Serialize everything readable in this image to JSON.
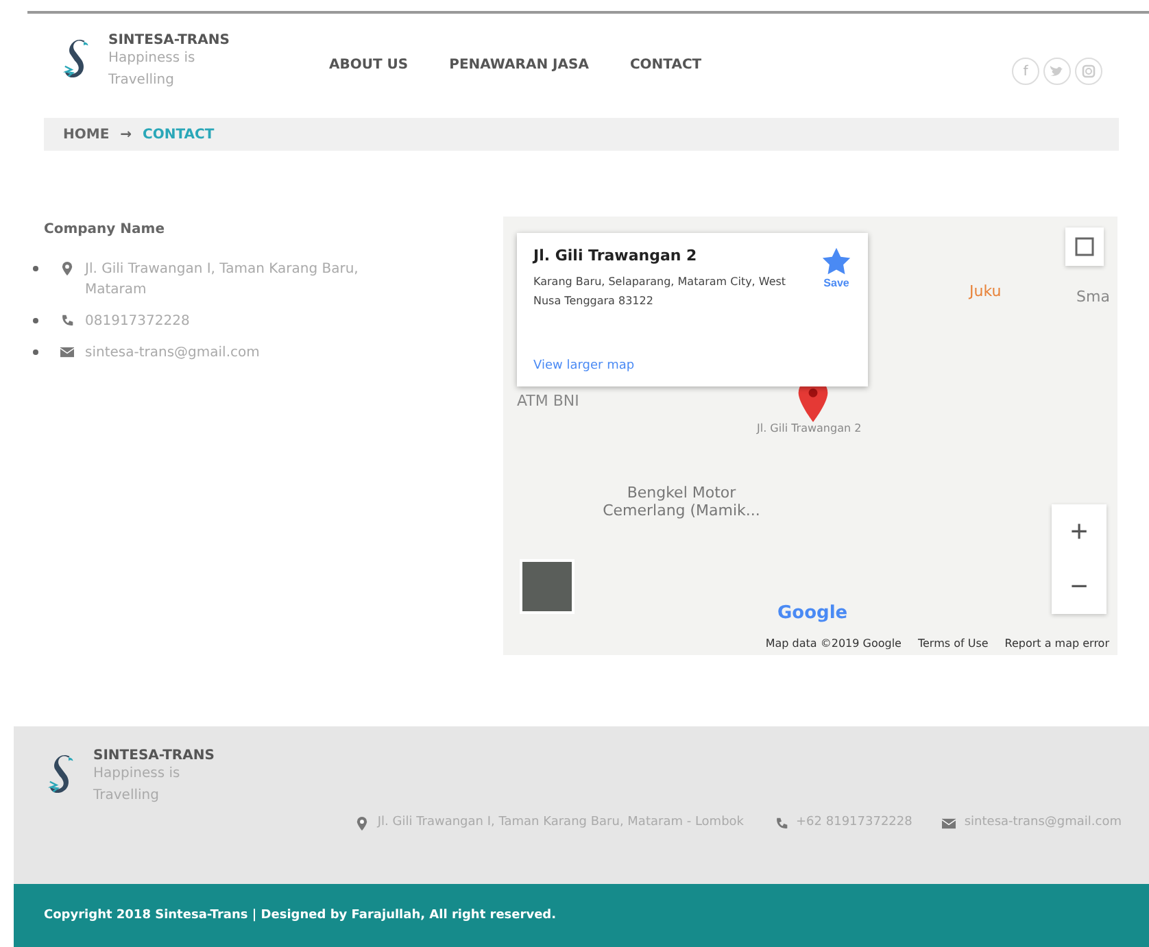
{
  "brand": {
    "name": "SINTESA-TRANS",
    "tagline": "Happiness is Travelling"
  },
  "nav": [
    {
      "label": "ABOUT US",
      "selected": false
    },
    {
      "label": "PENAWARAN JASA",
      "selected": false
    },
    {
      "label": "CONTACT",
      "selected": false
    }
  ],
  "social": [
    {
      "kind": "facebook",
      "label": "f"
    },
    {
      "kind": "twitter"
    },
    {
      "kind": "instagram"
    }
  ],
  "breadcrumb": [
    {
      "label": "HOME",
      "selected": false
    },
    {
      "label": "→",
      "selected": false
    },
    {
      "label": "CONTACT",
      "selected": true
    }
  ],
  "contact": {
    "title": "Company Name",
    "items": [
      {
        "kind": "address",
        "text": "Jl. Gili Trawangan I, Taman Karang Baru, Mataram"
      },
      {
        "kind": "phone",
        "text": "081917372228"
      },
      {
        "kind": "email",
        "text": "sintesa-trans@gmail.com"
      }
    ]
  },
  "map": {
    "card": {
      "title": "Jl. Gili Trawangan 2",
      "address": "Karang Baru, Selaparang, Mataram City, West Nusa Tenggara 83122",
      "save": "Save",
      "link": "View larger map"
    },
    "labels": [
      {
        "kind": "poi",
        "text": "ATM BNI"
      },
      {
        "kind": "food",
        "text": "Juku"
      },
      {
        "kind": "plain",
        "text": "Sma"
      },
      {
        "kind": "street",
        "text": "Jl. Gili Trawangan 2"
      },
      {
        "kind": "poi-dark",
        "text": "Bengkel Motor Cemerlang (Mamik..."
      }
    ],
    "zoom": [
      "+",
      "−"
    ],
    "logo": "Google",
    "attribution": [
      "Map data ©2019 Google",
      "Terms of Use",
      "Report a map error"
    ]
  },
  "footer": {
    "brand": {
      "name": "SINTESA-TRANS",
      "tagline": "Happiness is Travelling"
    },
    "items": [
      {
        "kind": "address",
        "text": "Jl. Gili Trawangan I, Taman Karang Baru, Mataram - Lombok"
      },
      {
        "kind": "phone",
        "text": "+62 81917372228"
      },
      {
        "kind": "email",
        "text": "sintesa-trans@gmail.com"
      }
    ],
    "copyright": "Copyright 2018 Sintesa-Trans | Designed by Farajullah, All right reserved."
  }
}
